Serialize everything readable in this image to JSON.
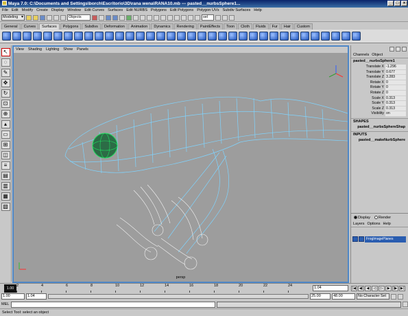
{
  "window": {
    "title": "Maya 7.0: C:\\Documents and Settings\\borch\\Escritorio\\3D\\rana wena\\RANA10.mb  ---  pasted__nurbsSphere1..."
  },
  "menubar": [
    "File",
    "Edit",
    "Modify",
    "Create",
    "Display",
    "Window",
    "Edit Curves",
    "Surfaces",
    "Edit NURBS",
    "Polygons",
    "Edit Polygons",
    "Polygon UVs",
    "Subdiv Surfaces",
    "Help"
  ],
  "status_line": {
    "mode": "Modeling",
    "selection_field": "Objects",
    "sel_field": "sel"
  },
  "shelf_tabs": [
    {
      "label": "General",
      "active": false
    },
    {
      "label": "Curves",
      "active": false
    },
    {
      "label": "Surfaces",
      "active": true
    },
    {
      "label": "Polygons",
      "active": false
    },
    {
      "label": "Subdivs",
      "active": false
    },
    {
      "label": "Deformation",
      "active": false
    },
    {
      "label": "Animation",
      "active": false
    },
    {
      "label": "Dynamics",
      "active": false
    },
    {
      "label": "Rendering",
      "active": false
    },
    {
      "label": "PaintEffects",
      "active": false
    },
    {
      "label": "Toon",
      "active": false
    },
    {
      "label": "Cloth",
      "active": false
    },
    {
      "label": "Fluids",
      "active": false
    },
    {
      "label": "Fur",
      "active": false
    },
    {
      "label": "Hair",
      "active": false
    },
    {
      "label": "Custom",
      "active": false
    }
  ],
  "viewport": {
    "menu": [
      "View",
      "Shading",
      "Lighting",
      "Show",
      "Panels"
    ],
    "camera_label": "persp"
  },
  "channel_box": {
    "menu": [
      "Channels",
      "Object"
    ],
    "object_name": "pasted__nurbsSphere1",
    "attributes": [
      {
        "label": "Translate X",
        "value": "-1.296"
      },
      {
        "label": "Translate Y",
        "value": "0.677"
      },
      {
        "label": "Translate Z",
        "value": "3.283"
      },
      {
        "label": "Rotate X",
        "value": "0"
      },
      {
        "label": "Rotate Y",
        "value": "0"
      },
      {
        "label": "Rotate Z",
        "value": "0"
      },
      {
        "label": "Scale X",
        "value": "0.313"
      },
      {
        "label": "Scale Y",
        "value": "0.313"
      },
      {
        "label": "Scale Z",
        "value": "0.313"
      },
      {
        "label": "Visibility",
        "value": "on"
      }
    ],
    "shapes_header": "SHAPES",
    "shape_name": "pasted__nurbsSphereShap",
    "inputs_header": "INPUTS",
    "input_name": "pasted__makeNurbSphere"
  },
  "layer_editor": {
    "display_label": "Display",
    "render_label": "Render",
    "menu": [
      "Layers",
      "Options",
      "Help"
    ],
    "layer_name": "FrogImagePlanes"
  },
  "time_slider": {
    "ticks": [
      "2",
      "4",
      "6",
      "8",
      "10",
      "12",
      "14",
      "16",
      "18",
      "20",
      "22",
      "24"
    ],
    "current_frame": "1.00",
    "current_time_field": "1.04"
  },
  "range_slider": {
    "start": "1.00",
    "playback_start": "1.04",
    "playback_end": "25.00",
    "end": "48.00",
    "character_set": "No Character Set"
  },
  "command_line": {
    "label": "MEL"
  },
  "help_line": "Select Tool: select an object"
}
